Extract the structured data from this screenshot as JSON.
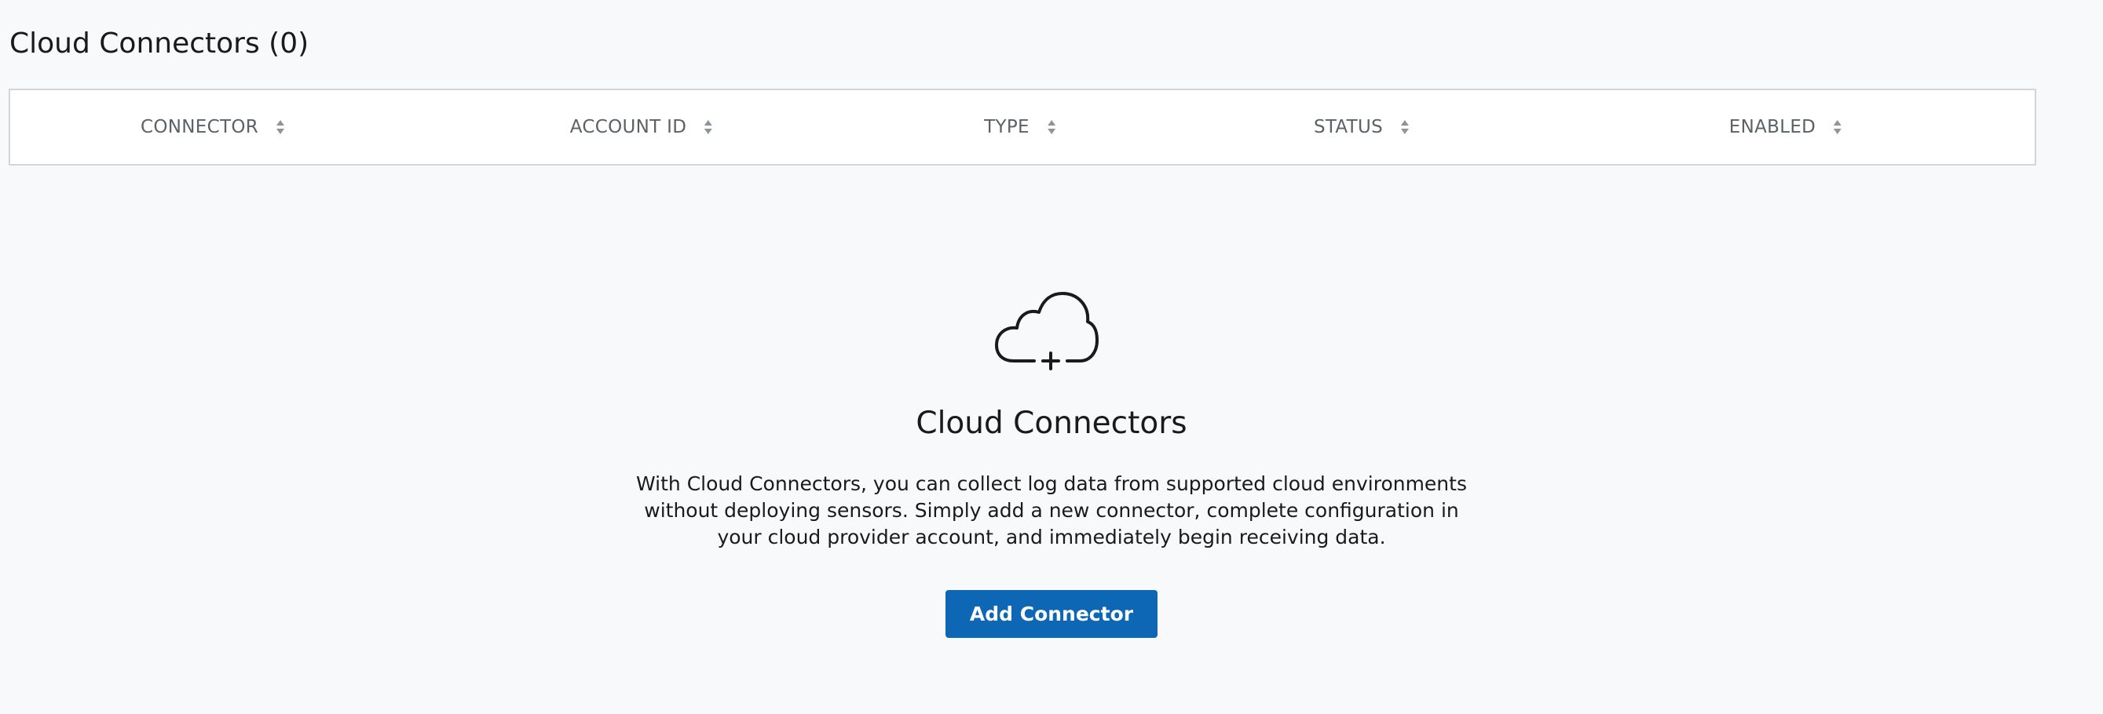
{
  "page": {
    "title": "Cloud Connectors (0)"
  },
  "table": {
    "columns": [
      {
        "label": "CONNECTOR",
        "sort_icon": "sort-both-icon"
      },
      {
        "label": "ACCOUNT ID",
        "sort_icon": "sort-both-icon"
      },
      {
        "label": "TYPE",
        "sort_icon": "sort-both-icon"
      },
      {
        "label": "STATUS",
        "sort_icon": "sort-both-icon"
      },
      {
        "label": "ENABLED",
        "sort_icon": "sort-both-icon"
      }
    ]
  },
  "empty_state": {
    "icon": "cloud-plus-icon",
    "title": "Cloud Connectors",
    "description": "With Cloud Connectors, you can collect log data from supported cloud environments without deploying sensors. Simply add a new connector, complete configuration in your cloud provider account, and immediately begin receiving data.",
    "button_label": "Add Connector"
  },
  "colors": {
    "background": "#f7f9fa",
    "primary_button": "#0e67b4",
    "header_text": "#5c6166",
    "border": "#d2d6d9"
  }
}
